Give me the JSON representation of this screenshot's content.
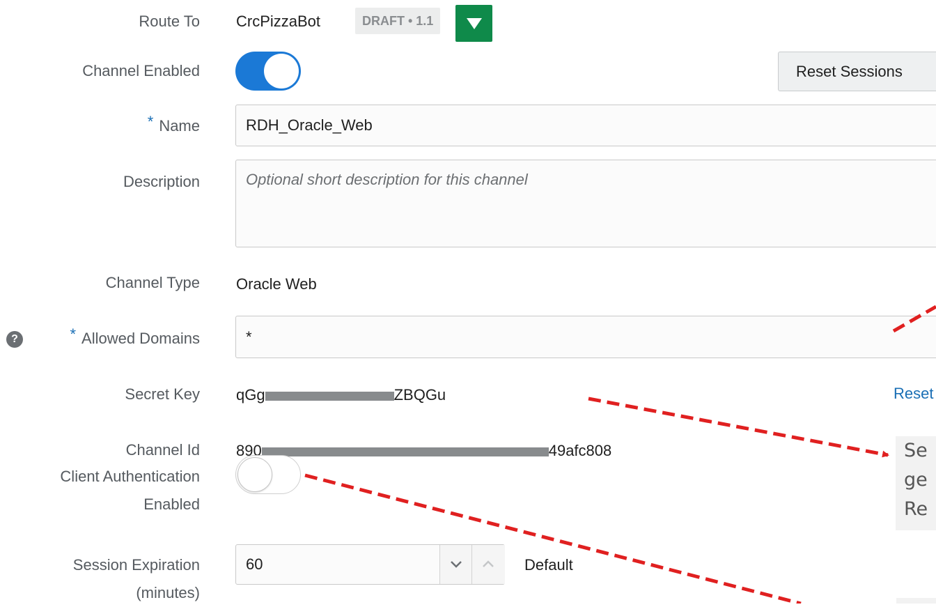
{
  "route_to": {
    "label": "Route To",
    "bot_name": "CrcPizzaBot",
    "version_badge": "DRAFT • 1.1"
  },
  "channel_enabled": {
    "label": "Channel Enabled",
    "value": true
  },
  "reset_sessions_button": "Reset Sessions",
  "name": {
    "required_mark": "*",
    "label": "Name",
    "value": "RDH_Oracle_Web"
  },
  "description": {
    "label": "Description",
    "placeholder": "Optional short description for this channel"
  },
  "channel_type": {
    "label": "Channel Type",
    "value": "Oracle Web"
  },
  "allowed_domains": {
    "help_icon": "?",
    "required_mark": "*",
    "label": "Allowed Domains",
    "value": "*"
  },
  "secret_key": {
    "label": "Secret Key",
    "prefix": "qGg",
    "suffix": "ZBQGu",
    "reset_link": "Reset"
  },
  "channel_id": {
    "label": "Channel Id",
    "prefix": "890",
    "suffix": "49afc808"
  },
  "client_auth": {
    "label_line1": "Client Authentication",
    "label_line2": "Enabled",
    "value": false
  },
  "session_expiration": {
    "label_line1": "Session Expiration",
    "label_line2": "(minutes)",
    "value": "60",
    "default_label": "Default"
  },
  "callout": {
    "line1": "Se",
    "line2": "ge",
    "line3": "Re"
  },
  "colors": {
    "accent": "#1b79d6",
    "green_button": "#0f8a4a",
    "arrow": "#e02020",
    "link": "#1a6fb5"
  }
}
